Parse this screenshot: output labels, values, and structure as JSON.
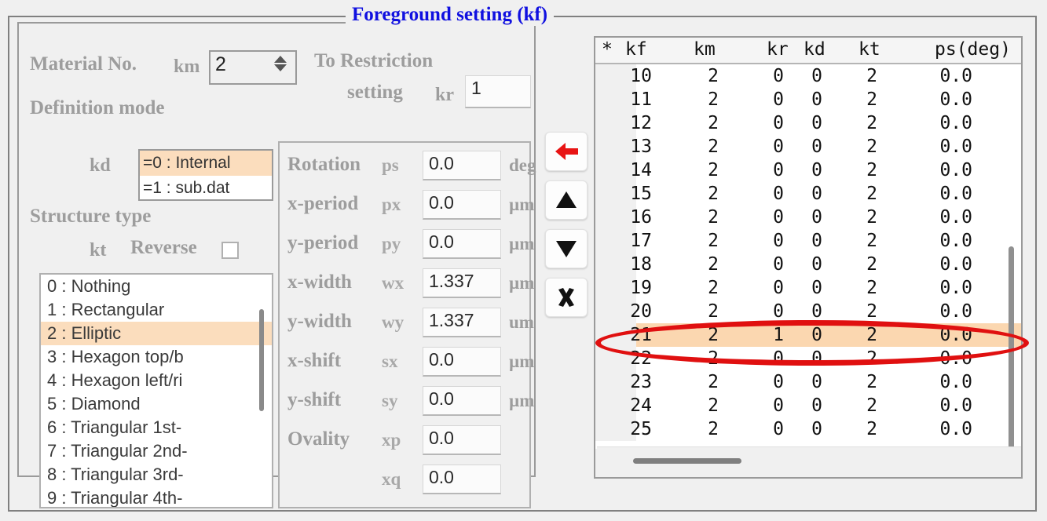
{
  "window": {
    "group_title": "Foreground setting (kf)",
    "accent_color": "#1010e0",
    "highlight_color": "#fbddbd",
    "annotation_color": "#e01010"
  },
  "left_panel": {
    "material_label": "Material No.",
    "material_symbol": "km",
    "material_value": "2",
    "restriction_label_line1": "To Restriction",
    "restriction_label_line2": "setting",
    "restriction_symbol": "kr",
    "restriction_value": "1",
    "definition_mode_label": "Definition mode",
    "definition_symbol": "kd",
    "definition_options": [
      {
        "label": "=0 : Internal",
        "selected": true
      },
      {
        "label": "=1 : sub.dat",
        "selected": false
      }
    ],
    "structure_type_label": "Structure type",
    "structure_symbol": "kt",
    "reverse_label": "Reverse",
    "reverse_checked": false,
    "structure_list": [
      {
        "label": "0 : Nothing",
        "selected": false
      },
      {
        "label": "1 : Rectangular",
        "selected": false
      },
      {
        "label": "2 : Elliptic",
        "selected": true
      },
      {
        "label": "3 : Hexagon top/b",
        "selected": false
      },
      {
        "label": "4 : Hexagon left/ri",
        "selected": false
      },
      {
        "label": "5 : Diamond",
        "selected": false
      },
      {
        "label": "6 : Triangular 1st-",
        "selected": false
      },
      {
        "label": "7 : Triangular 2nd-",
        "selected": false
      },
      {
        "label": "8 : Triangular 3rd-",
        "selected": false
      },
      {
        "label": "9 : Triangular 4th-",
        "selected": false
      }
    ]
  },
  "params": [
    {
      "name": "Rotation",
      "symbol": "ps",
      "value": "0.0",
      "unit": "deg"
    },
    {
      "name": "x-period",
      "symbol": "px",
      "value": "0.0",
      "unit": "µm"
    },
    {
      "name": "y-period",
      "symbol": "py",
      "value": "0.0",
      "unit": "µm"
    },
    {
      "name": "x-width",
      "symbol": "wx",
      "value": "1.337",
      "unit": "µm"
    },
    {
      "name": "y-width",
      "symbol": "wy",
      "value": "1.337",
      "unit": "um"
    },
    {
      "name": "x-shift",
      "symbol": "sx",
      "value": "0.0",
      "unit": "µm"
    },
    {
      "name": "y-shift",
      "symbol": "sy",
      "value": "0.0",
      "unit": "µm"
    },
    {
      "name": "Ovality",
      "symbol": "xp",
      "value": "0.0",
      "unit": ""
    },
    {
      "name": "",
      "symbol": "xq",
      "value": "0.0",
      "unit": ""
    }
  ],
  "buttons": [
    {
      "name": "move-left-button",
      "icon": "arrow-left-icon"
    },
    {
      "name": "move-up-button",
      "icon": "triangle-up-icon"
    },
    {
      "name": "move-down-button",
      "icon": "triangle-down-icon"
    },
    {
      "name": "delete-button",
      "icon": "close-x-icon"
    }
  ],
  "table": {
    "columns": [
      "*",
      "kf",
      "km",
      "kr",
      "kd",
      "kt",
      "ps(deg)"
    ],
    "rows": [
      {
        "kf": "10",
        "km": "2",
        "kr": "0",
        "kd": "0",
        "kt": "2",
        "ps": "0.0",
        "selected": false
      },
      {
        "kf": "11",
        "km": "2",
        "kr": "0",
        "kd": "0",
        "kt": "2",
        "ps": "0.0",
        "selected": false
      },
      {
        "kf": "12",
        "km": "2",
        "kr": "0",
        "kd": "0",
        "kt": "2",
        "ps": "0.0",
        "selected": false
      },
      {
        "kf": "13",
        "km": "2",
        "kr": "0",
        "kd": "0",
        "kt": "2",
        "ps": "0.0",
        "selected": false
      },
      {
        "kf": "14",
        "km": "2",
        "kr": "0",
        "kd": "0",
        "kt": "2",
        "ps": "0.0",
        "selected": false
      },
      {
        "kf": "15",
        "km": "2",
        "kr": "0",
        "kd": "0",
        "kt": "2",
        "ps": "0.0",
        "selected": false
      },
      {
        "kf": "16",
        "km": "2",
        "kr": "0",
        "kd": "0",
        "kt": "2",
        "ps": "0.0",
        "selected": false
      },
      {
        "kf": "17",
        "km": "2",
        "kr": "0",
        "kd": "0",
        "kt": "2",
        "ps": "0.0",
        "selected": false
      },
      {
        "kf": "18",
        "km": "2",
        "kr": "0",
        "kd": "0",
        "kt": "2",
        "ps": "0.0",
        "selected": false
      },
      {
        "kf": "19",
        "km": "2",
        "kr": "0",
        "kd": "0",
        "kt": "2",
        "ps": "0.0",
        "selected": false
      },
      {
        "kf": "20",
        "km": "2",
        "kr": "0",
        "kd": "0",
        "kt": "2",
        "ps": "0.0",
        "selected": false
      },
      {
        "kf": "21",
        "km": "2",
        "kr": "1",
        "kd": "0",
        "kt": "2",
        "ps": "0.0",
        "selected": true
      },
      {
        "kf": "22",
        "km": "2",
        "kr": "0",
        "kd": "0",
        "kt": "2",
        "ps": "0.0",
        "selected": false
      },
      {
        "kf": "23",
        "km": "2",
        "kr": "0",
        "kd": "0",
        "kt": "2",
        "ps": "0.0",
        "selected": false
      },
      {
        "kf": "24",
        "km": "2",
        "kr": "0",
        "kd": "0",
        "kt": "2",
        "ps": "0.0",
        "selected": false
      },
      {
        "kf": "25",
        "km": "2",
        "kr": "0",
        "kd": "0",
        "kt": "2",
        "ps": "0.0",
        "selected": false
      }
    ]
  }
}
